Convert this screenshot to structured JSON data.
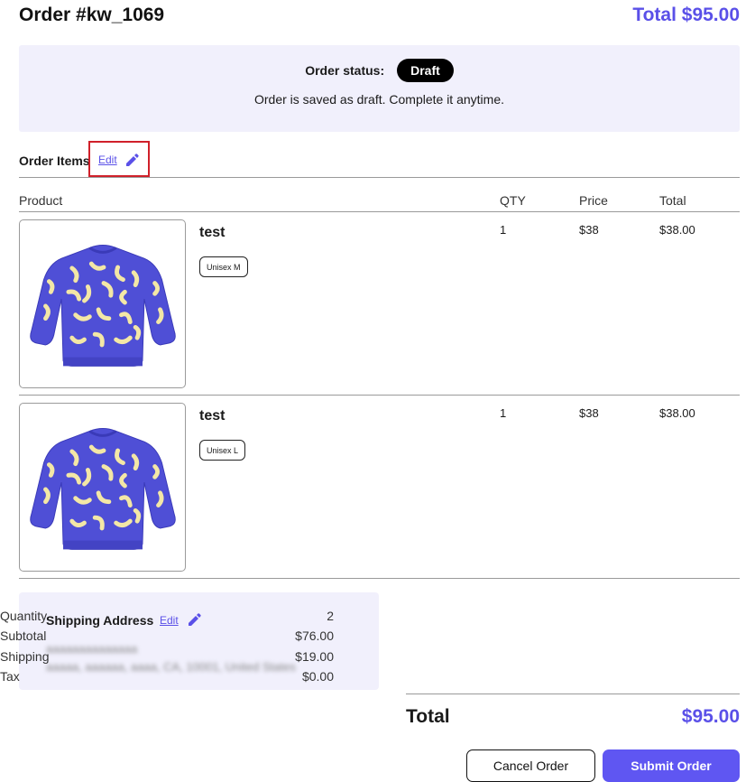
{
  "header": {
    "order_title": "Order #kw_1069",
    "total_label": "Total $95.00"
  },
  "status": {
    "label": "Order status:",
    "badge": "Draft",
    "message": "Order is saved as draft. Complete it anytime."
  },
  "order_items": {
    "title": "Order Items",
    "edit_label": "Edit"
  },
  "table": {
    "columns": [
      "Product",
      "QTY",
      "Price",
      "Total"
    ],
    "rows": [
      {
        "name": "test",
        "variant": "Unisex M",
        "qty": "1",
        "price": "$38",
        "total": "$38.00"
      },
      {
        "name": "test",
        "variant": "Unisex L",
        "qty": "1",
        "price": "$38",
        "total": "$38.00"
      }
    ]
  },
  "shipping": {
    "title": "Shipping Address",
    "edit_label": "Edit",
    "line1": "aaaaaaaaaaaaaa",
    "line2": "aaaaa, aaaaaa, aaaa, CA, 10001, United States"
  },
  "summary": {
    "rows": [
      {
        "label": "Quantity",
        "value": "2"
      },
      {
        "label": "Subtotal",
        "value": "$76.00"
      },
      {
        "label": "Shipping",
        "value": "$19.00"
      },
      {
        "label": "Tax",
        "value": "$0.00"
      }
    ],
    "total_label": "Total",
    "total_value": "$95.00"
  },
  "actions": {
    "cancel_label": "Cancel Order",
    "submit_label": "Submit Order"
  },
  "colors": {
    "accent": "#5a50e8",
    "panel": "#f1f0fc",
    "highlight_box": "#d0202a",
    "sweater_body": "#4f4fd6",
    "sweater_pattern": "#f3e7a6"
  },
  "icons": {
    "edit": "pencil-icon",
    "product": "sweater-image"
  }
}
